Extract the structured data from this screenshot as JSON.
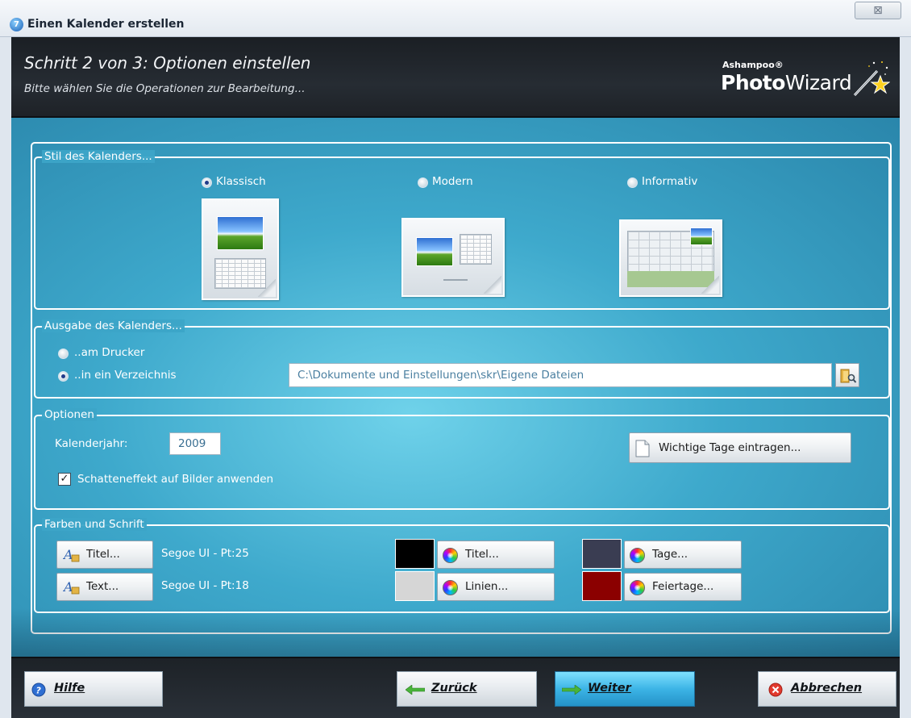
{
  "window": {
    "title": "Einen Kalender erstellen",
    "app_icon_glyph": "7",
    "close_glyph": "⊠"
  },
  "header": {
    "step_title": "Schritt 2 von 3: Optionen einstellen",
    "step_subtitle": "Bitte wählen Sie die Operationen zur Bearbeitung...",
    "brand_small": "Ashampoo®",
    "brand_big_bold": "Photo",
    "brand_big_regular": "Wizard"
  },
  "style_group": {
    "legend": "Stil des Kalenders...",
    "options": [
      {
        "label": "Klassisch",
        "selected": true
      },
      {
        "label": "Modern",
        "selected": false
      },
      {
        "label": "Informativ",
        "selected": false
      }
    ]
  },
  "output_group": {
    "legend": "Ausgabe des Kalenders...",
    "printer_label": "..am Drucker",
    "printer_selected": false,
    "folder_label": "..in ein Verzeichnis",
    "folder_selected": true,
    "path_value": "C:\\Dokumente und Einstellungen\\skr\\Eigene Dateien",
    "browse_icon": "folder-search-icon"
  },
  "options_group": {
    "legend": "Optionen",
    "year_label": "Kalenderjahr:",
    "year_value": "2009",
    "shadow_label": "Schatteneffekt auf Bilder anwenden",
    "shadow_checked": true,
    "check_glyph": "✓",
    "important_days_label": "Wichtige Tage eintragen..."
  },
  "fonts_group": {
    "legend": "Farben und Schrift",
    "title_font_button": "Titel...",
    "title_font_value": "Segoe UI - Pt:25",
    "text_font_button": "Text...",
    "text_font_value": "Segoe UI - Pt:18",
    "colors": [
      {
        "label": "Titel...",
        "color": "#000000"
      },
      {
        "label": "Linien...",
        "color": "#d6d6d6"
      },
      {
        "label": "Tage...",
        "color": "#3a3d52"
      },
      {
        "label": "Feiertage...",
        "color": "#8b0000"
      }
    ]
  },
  "footer": {
    "help_label": "Hilfe",
    "back_label": "Zurück",
    "next_label": "Weiter",
    "cancel_label": "Abbrechen"
  },
  "colors": {
    "accent": "#3cb4e6",
    "header_bg": "#1e2227"
  }
}
